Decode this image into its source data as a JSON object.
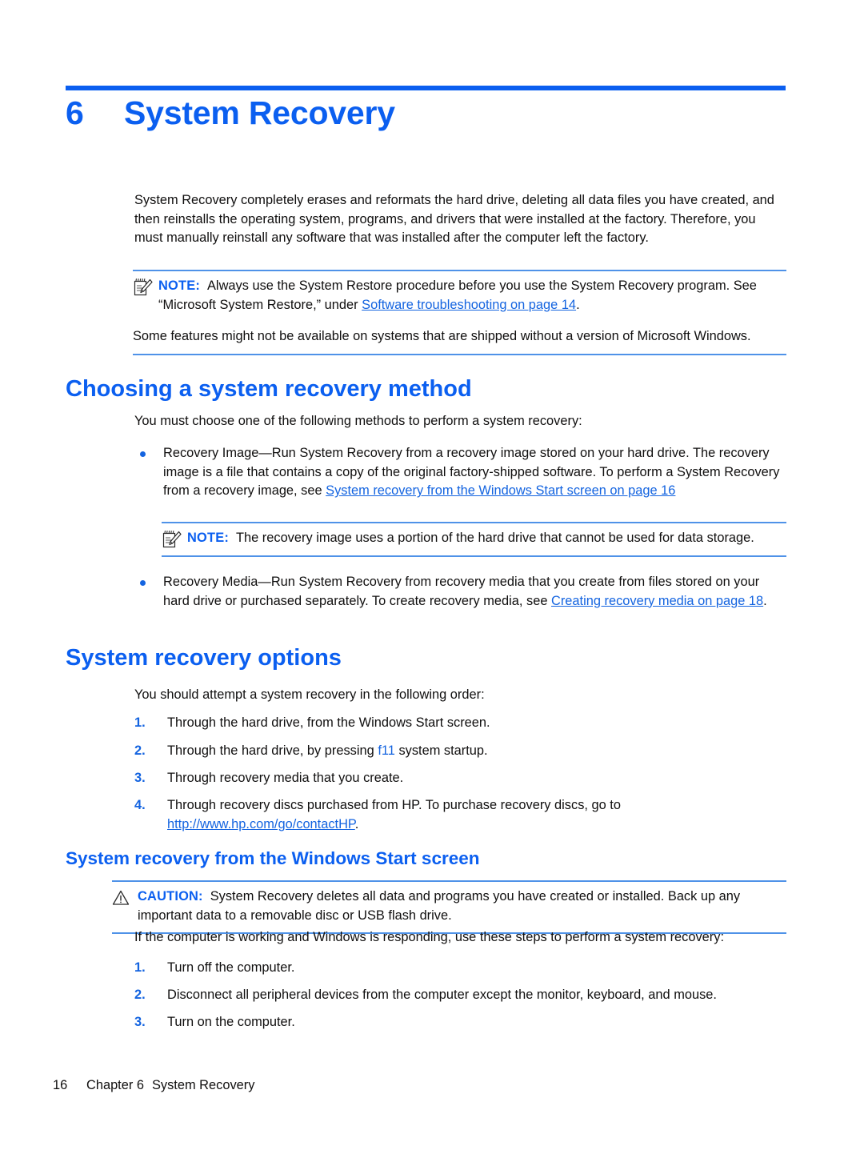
{
  "document": {
    "chapter_number": "6",
    "chapter_title": "System Recovery"
  },
  "intro": {
    "paragraph": "System Recovery completely erases and reformats the hard drive, deleting all data files you have created, and then reinstalls the operating system, programs, and drivers that were installed at the factory. Therefore, you must manually reinstall any software that was installed after the computer left the factory."
  },
  "note_restore": {
    "icon": "note-icon",
    "label": "NOTE:",
    "text_before_link": "Always use the System Restore procedure before you use the System Recovery program. See “Microsoft System Restore,” under ",
    "link": "Software troubleshooting on page 14",
    "text_after_link": ".",
    "following_paragraph": "Some features might not be available on systems that are shipped without a version of Microsoft Windows."
  },
  "section_choosing": {
    "heading": "Choosing a system recovery method",
    "intro": "You must choose one of the following methods to perform a system recovery:",
    "bullets": [
      {
        "text_before_link": "Recovery Image—Run System Recovery from a recovery image stored on your hard drive. The recovery image is a file that contains a copy of the original factory-shipped software. To perform a System Recovery from a recovery image, see ",
        "link": "System recovery from the Windows Start screen on page 16",
        "text_after_link": ""
      },
      {
        "text_before_link": "Recovery Media—Run System Recovery from recovery media that you create from files stored on your hard drive or purchased separately. To create recovery media, see ",
        "link": "Creating recovery media on page 18",
        "text_after_link": "."
      }
    ],
    "note_image": {
      "icon": "note-icon",
      "label": "NOTE:",
      "text": "The recovery image uses a portion of the hard drive that cannot be used for data storage."
    }
  },
  "section_options": {
    "heading": "System recovery options",
    "intro": "You should attempt a system recovery in the following order:",
    "steps": [
      {
        "marker": "1.",
        "text_before_key": "Through the hard drive, from the Windows Start screen.",
        "key": "",
        "text_after_key": "",
        "link": "",
        "text_after_link": ""
      },
      {
        "marker": "2.",
        "text_before_key": "Through the hard drive, by pressing ",
        "key": "f11",
        "text_after_key": " system startup.",
        "link": "",
        "text_after_link": ""
      },
      {
        "marker": "3.",
        "text_before_key": "Through recovery media that you create.",
        "key": "",
        "text_after_key": "",
        "link": "",
        "text_after_link": ""
      },
      {
        "marker": "4.",
        "text_before_key": "Through recovery discs purchased from HP. To purchase recovery discs, go to ",
        "key": "",
        "text_after_key": "",
        "link": "http://www.hp.com/go/contactHP",
        "text_after_link": "."
      }
    ]
  },
  "section_start_screen": {
    "heading": "System recovery from the Windows Start screen",
    "caution": {
      "icon": "caution-icon",
      "label": "CAUTION:",
      "text": "System Recovery deletes all data and programs you have created or installed. Back up any important data to a removable disc or USB flash drive."
    },
    "intro": "If the computer is working and Windows is responding, use these steps to perform a system recovery:",
    "steps": [
      {
        "marker": "1.",
        "text": "Turn off the computer."
      },
      {
        "marker": "2.",
        "text": "Disconnect all peripheral devices from the computer except the monitor, keyboard, and mouse."
      },
      {
        "marker": "3.",
        "text": "Turn on the computer."
      }
    ]
  },
  "footer": {
    "page_number": "16",
    "chapter_label": "Chapter 6",
    "chapter_title": "System Recovery"
  },
  "colors": {
    "accent_blue": "#0b5ff0",
    "link_blue": "#1464e0",
    "rule_blue": "#4f92e8",
    "body_black": "#100f0f"
  }
}
